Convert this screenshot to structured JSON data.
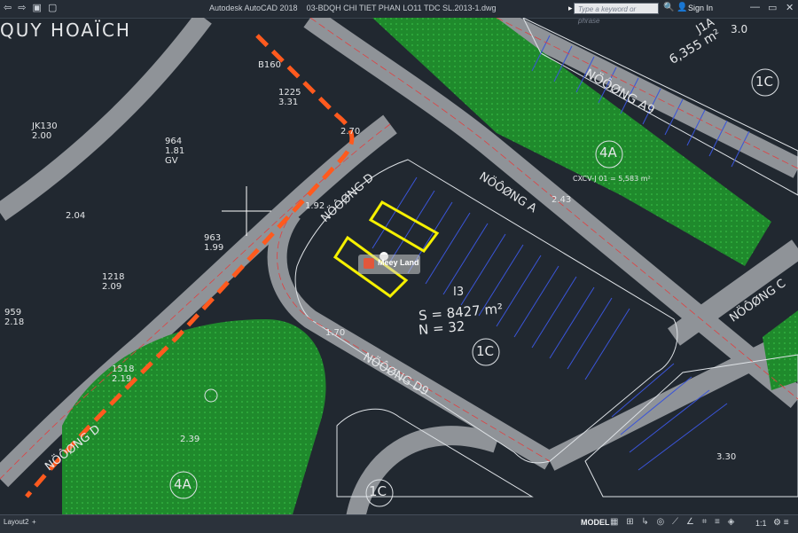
{
  "window": {
    "app_name": "Autodesk AutoCAD 2018",
    "file_name": "03-BDQH CHI TIET PHAN LO11 TDC SL.2013-1.dwg",
    "search_placeholder": "Type a keyword or phrase",
    "sign_in": "Sign In"
  },
  "drawing": {
    "title_top_left": "QUY HOAÏCH",
    "roads": [
      "NÖÔØNG A9",
      "NÖÔØNG D",
      "NÖÔØNG A",
      "NÖÔØNG C",
      "NÖÔØNG D9",
      "NÖÔØNG D"
    ],
    "zones": [
      "4A",
      "1C",
      "4A",
      "1C",
      "1C"
    ],
    "block_area_label": "S = 8427 m²",
    "block_count_label": "N = 32",
    "block_name": "I3",
    "green_area_label": "CXCV-J 01 = 5,583 m²",
    "top_right_area": "J1A",
    "top_right_area_value": "6,355 m²",
    "lot_labels": [
      "1225",
      "3.31",
      "964",
      "1.81",
      "GV",
      "963",
      "1.99",
      "1218",
      "2.09",
      "959",
      "2.18",
      "1518",
      "2.19",
      "JK130",
      "2.00",
      "2.04",
      "2.39",
      "1.92",
      "1.70",
      "2.43",
      "2.70",
      "3.30",
      "B160",
      "3.0"
    ]
  },
  "status_bar": {
    "layout_tab": "Layout2",
    "model": "MODEL",
    "scale": "1:1"
  },
  "watermark": "Meey Land",
  "colors": {
    "background": "#212830",
    "road": "#9a9ea3",
    "green": "#1e8a2a",
    "boundary": "#ff5a1e",
    "highlight": "#f0f000",
    "lotline": "#2d46c8"
  }
}
